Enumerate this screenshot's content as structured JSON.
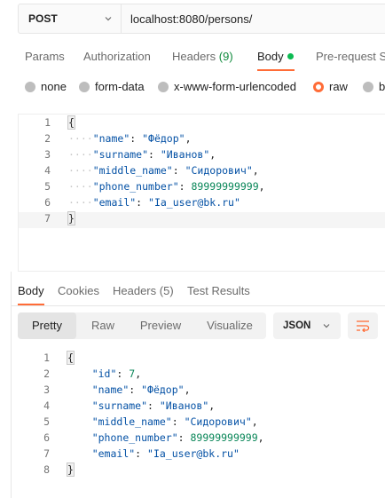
{
  "request": {
    "method": "POST",
    "url": "localhost:8080/persons/",
    "tabs": [
      {
        "label": "Params"
      },
      {
        "label": "Authorization"
      },
      {
        "label": "Headers",
        "count": "(9)"
      },
      {
        "label": "Body",
        "active": true
      },
      {
        "label": "Pre-request S"
      }
    ],
    "body_types": [
      {
        "label": "none"
      },
      {
        "label": "form-data"
      },
      {
        "label": "x-www-form-urlencoded"
      },
      {
        "label": "raw",
        "selected": true
      },
      {
        "label": "bi"
      }
    ],
    "body_lines": [
      {
        "n": "1"
      },
      {
        "n": "2",
        "key": "\"name\"",
        "val": "\"Фёдор\""
      },
      {
        "n": "3",
        "key": "\"surname\"",
        "val": "\"Иванов\""
      },
      {
        "n": "4",
        "key": "\"middle_name\"",
        "val": "\"Сидорович\""
      },
      {
        "n": "5",
        "key": "\"phone_number\"",
        "val": "89999999999"
      },
      {
        "n": "6",
        "key": "\"email\"",
        "val": "\"Ia_user@bk.ru\""
      },
      {
        "n": "7"
      }
    ]
  },
  "response": {
    "tabs": [
      {
        "label": "Body",
        "active": true
      },
      {
        "label": "Cookies"
      },
      {
        "label": "Headers",
        "count": "(5)"
      },
      {
        "label": "Test Results"
      }
    ],
    "views": [
      {
        "label": "Pretty",
        "active": true
      },
      {
        "label": "Raw"
      },
      {
        "label": "Preview"
      },
      {
        "label": "Visualize"
      }
    ],
    "format": "JSON",
    "body_lines": [
      {
        "n": "1"
      },
      {
        "n": "2",
        "key": "\"id\"",
        "val": "7"
      },
      {
        "n": "3",
        "key": "\"name\"",
        "val": "\"Фёдор\""
      },
      {
        "n": "4",
        "key": "\"surname\"",
        "val": "\"Иванов\""
      },
      {
        "n": "5",
        "key": "\"middle_name\"",
        "val": "\"Сидорович\""
      },
      {
        "n": "6",
        "key": "\"phone_number\"",
        "val": "89999999999"
      },
      {
        "n": "7",
        "key": "\"email\"",
        "val": "\"Ia_user@bk.ru\""
      },
      {
        "n": "8"
      }
    ]
  },
  "brackets": {
    "open": "{",
    "close": "}"
  },
  "punct": {
    "colon": ": ",
    "comma": ","
  },
  "icons": {
    "method_chevron": "chevron-down-icon",
    "format_chevron": "chevron-down-icon",
    "wrap": "wrap-lines-icon"
  },
  "colors": {
    "accent": "#ff6c37",
    "active_dot": "#0cbb52",
    "count": "#0f8a3c",
    "json_key": "#0451a5",
    "json_number": "#098658"
  }
}
